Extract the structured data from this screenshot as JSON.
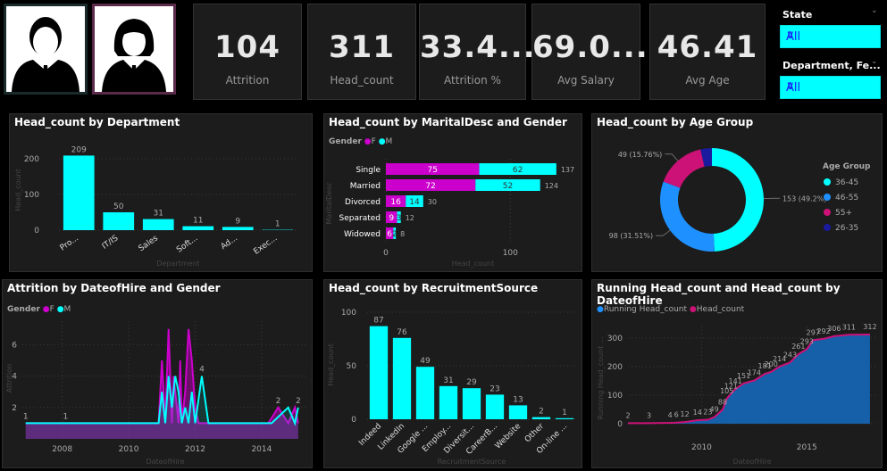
{
  "kpis": [
    {
      "value": "104",
      "label": "Attrition"
    },
    {
      "value": "311",
      "label": "Head_count"
    },
    {
      "value": "33.4...",
      "label": "Attrition %"
    },
    {
      "value": "69.0...",
      "label": "Avg Salary"
    },
    {
      "value": "46.41",
      "label": "Avg Age"
    }
  ],
  "slicers": [
    {
      "title": "State",
      "value": "All"
    },
    {
      "title": "Department, Fe...",
      "value": "All"
    }
  ],
  "colors": {
    "cyan": "#00ffff",
    "magenta": "#cc00cc",
    "blue": "#1e90ff",
    "navy": "#1a1a9e",
    "pink": "#cc1177"
  },
  "panels": {
    "dept": {
      "title": "Head_count by Department",
      "ylabel": "Head_count",
      "xlabel": "Department"
    },
    "marital": {
      "title": "Head_count by MaritalDesc and Gender",
      "legend_title": "Gender",
      "legend": [
        "F",
        "M"
      ],
      "ylabel": "MaritalDesc",
      "xlabel": "Head_count"
    },
    "age": {
      "title": "Head_count by Age Group",
      "legend_title": "Age Group"
    },
    "attrition": {
      "title": "Attrition by DateofHire and Gender",
      "legend_title": "Gender",
      "legend": [
        "F",
        "M"
      ],
      "ylabel": "Attrition",
      "xlabel": "DateofHire"
    },
    "recruit": {
      "title": "Head_count by RecruitmentSource",
      "ylabel": "Head_count",
      "xlabel": "RecruitmentSource"
    },
    "running": {
      "title": "Running Head_count and Head_count by DateofHire",
      "legend": [
        "Running Head_count",
        "Head_count"
      ],
      "ylabel": "Running Head_count ...",
      "xlabel": "DateofHire"
    }
  },
  "chart_data": [
    {
      "type": "bar",
      "title": "Head_count by Department",
      "categories": [
        "Pro...",
        "IT/IS",
        "Sales",
        "Soft...",
        "Ad...",
        "Exec..."
      ],
      "values": [
        209,
        50,
        31,
        11,
        9,
        1
      ],
      "ylim": [
        0,
        230
      ],
      "yticks": [
        0,
        100,
        200
      ],
      "xlabel": "Department",
      "ylabel": "Head_count"
    },
    {
      "type": "bar",
      "orientation": "horizontal-stacked",
      "title": "Head_count by MaritalDesc and Gender",
      "categories": [
        "Single",
        "Married",
        "Divorced",
        "Separated",
        "Widowed"
      ],
      "series": [
        {
          "name": "F",
          "values": [
            75,
            72,
            16,
            9,
            6
          ]
        },
        {
          "name": "M",
          "values": [
            62,
            52,
            14,
            3,
            2
          ]
        }
      ],
      "totals": [
        137,
        124,
        30,
        12,
        8
      ],
      "xlim": [
        0,
        140
      ],
      "xticks": [
        0,
        100
      ],
      "xlabel": "Head_count",
      "ylabel": "MaritalDesc"
    },
    {
      "type": "pie",
      "title": "Head_count by Age Group",
      "labels": [
        "36-45",
        "46-55",
        "55+",
        "26-35"
      ],
      "values": [
        153,
        98,
        49,
        11
      ],
      "colors": [
        "#00ffff",
        "#1e90ff",
        "#cc1177",
        "#1a1a9e"
      ],
      "data_labels": [
        "153 (49.2%)",
        "98 (31.51%)",
        "49 (15.76%)",
        ""
      ]
    },
    {
      "type": "area",
      "title": "Attrition by DateofHire and Gender",
      "xlim": [
        2006.8,
        2015.4
      ],
      "xticks": [
        2008,
        2010,
        2012,
        2014
      ],
      "yticks": [
        2,
        4,
        6
      ],
      "ylim": [
        0,
        7.5
      ],
      "xlabel": "DateofHire",
      "ylabel": "Attrition",
      "series": [
        {
          "name": "F",
          "points": [
            [
              2006.9,
              1
            ],
            [
              2008.1,
              1
            ],
            [
              2010.9,
              1
            ],
            [
              2011.0,
              5
            ],
            [
              2011.1,
              1
            ],
            [
              2011.2,
              7
            ],
            [
              2011.3,
              1
            ],
            [
              2011.35,
              4
            ],
            [
              2011.5,
              1
            ],
            [
              2011.55,
              5
            ],
            [
              2011.6,
              1
            ],
            [
              2011.7,
              3
            ],
            [
              2011.8,
              7
            ],
            [
              2011.9,
              5
            ],
            [
              2012.0,
              2
            ],
            [
              2012.1,
              1
            ],
            [
              2012.3,
              1
            ],
            [
              2014.2,
              1
            ],
            [
              2014.5,
              2
            ],
            [
              2014.8,
              1
            ],
            [
              2015.0,
              2
            ],
            [
              2015.1,
              1
            ]
          ]
        },
        {
          "name": "M",
          "points": [
            [
              2006.9,
              1
            ],
            [
              2008.1,
              1
            ],
            [
              2010.9,
              1
            ],
            [
              2011.0,
              3
            ],
            [
              2011.1,
              1
            ],
            [
              2011.2,
              4
            ],
            [
              2011.3,
              2
            ],
            [
              2011.4,
              4
            ],
            [
              2011.5,
              3
            ],
            [
              2011.6,
              1
            ],
            [
              2011.7,
              2
            ],
            [
              2011.8,
              1
            ],
            [
              2011.9,
              3
            ],
            [
              2012.0,
              1
            ],
            [
              2012.2,
              4
            ],
            [
              2012.4,
              1
            ],
            [
              2014.3,
              1
            ],
            [
              2014.8,
              2
            ],
            [
              2015.0,
              1
            ],
            [
              2015.1,
              2
            ]
          ]
        }
      ],
      "data_labels": [
        {
          "x": 2006.9,
          "y": 1,
          "text": "1"
        },
        {
          "x": 2008.1,
          "y": 1,
          "text": "1"
        },
        {
          "x": 2012.2,
          "y": 4,
          "text": "4"
        },
        {
          "x": 2014.5,
          "y": 2,
          "text": "2"
        },
        {
          "x": 2015.1,
          "y": 2,
          "text": "2"
        }
      ]
    },
    {
      "type": "bar",
      "title": "Head_count by RecruitmentSource",
      "categories": [
        "Indeed",
        "LinkedIn",
        "Google ...",
        "Employ...",
        "Diversit...",
        "CareerB...",
        "Website",
        "Other",
        "On-line ..."
      ],
      "values": [
        87,
        76,
        49,
        31,
        29,
        23,
        13,
        2,
        1
      ],
      "ylim": [
        0,
        105
      ],
      "yticks": [
        0,
        50,
        100
      ],
      "xlabel": "RecruitmentSource",
      "ylabel": "Head_count"
    },
    {
      "type": "area",
      "title": "Running Head_count and Head_count by DateofHire",
      "xlim": [
        2006.5,
        2018.3
      ],
      "xticks": [
        2010,
        2015
      ],
      "yticks": [
        0,
        100,
        200,
        300
      ],
      "ylim": [
        0,
        340
      ],
      "xlabel": "DateofHire",
      "ylabel": "Running Head_count ...",
      "series": [
        {
          "name": "Running Head_count",
          "points": [
            [
              2006.5,
              2
            ],
            [
              2007.5,
              2
            ],
            [
              2008.5,
              3
            ],
            [
              2008.8,
              4
            ],
            [
              2009.2,
              6
            ],
            [
              2009.8,
              12
            ],
            [
              2010.3,
              14
            ],
            [
              2010.6,
              23
            ],
            [
              2011.0,
              49
            ],
            [
              2011.2,
              88
            ],
            [
              2011.4,
              105
            ],
            [
              2011.6,
              121
            ],
            [
              2012.0,
              141
            ],
            [
              2012.5,
              151
            ],
            [
              2013.0,
              174
            ],
            [
              2013.3,
              181
            ],
            [
              2013.7,
              200
            ],
            [
              2014.2,
              214
            ],
            [
              2014.6,
              243
            ],
            [
              2015.0,
              261
            ],
            [
              2015.3,
              293
            ],
            [
              2015.8,
              297
            ],
            [
              2016.3,
              306
            ],
            [
              2017.0,
              311
            ],
            [
              2018.0,
              312
            ]
          ]
        },
        {
          "name": "Head_count",
          "points": [
            [
              2006.5,
              2
            ],
            [
              2007.5,
              2
            ],
            [
              2008.5,
              3
            ],
            [
              2008.8,
              4
            ],
            [
              2009.2,
              6
            ],
            [
              2009.8,
              12
            ],
            [
              2010.3,
              14
            ],
            [
              2010.6,
              23
            ],
            [
              2011.0,
              49
            ],
            [
              2011.2,
              88
            ],
            [
              2011.4,
              105
            ],
            [
              2011.6,
              121
            ],
            [
              2012.0,
              141
            ],
            [
              2012.5,
              151
            ],
            [
              2013.0,
              174
            ],
            [
              2013.3,
              181
            ],
            [
              2013.7,
              200
            ],
            [
              2014.2,
              214
            ],
            [
              2014.6,
              243
            ],
            [
              2015.0,
              261
            ],
            [
              2015.3,
              292
            ],
            [
              2015.8,
              297
            ],
            [
              2016.3,
              306
            ],
            [
              2017.0,
              311
            ],
            [
              2018.0,
              312
            ]
          ]
        }
      ],
      "data_labels": [
        "2",
        "3",
        "4",
        "6",
        "12",
        "14",
        "23",
        "49",
        "88",
        "105",
        "121",
        "141",
        "151",
        "174",
        "181",
        "200",
        "214",
        "243",
        "261",
        "293",
        "297",
        "292",
        "306",
        "311",
        "312"
      ]
    }
  ]
}
